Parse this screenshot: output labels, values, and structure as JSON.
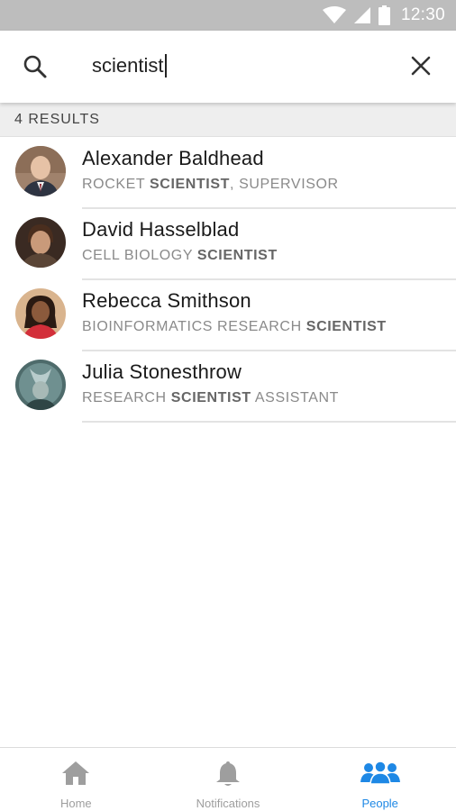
{
  "status_bar": {
    "time": "12:30"
  },
  "search": {
    "query": "scientist"
  },
  "results_header": {
    "count_label": "4 RESULTS"
  },
  "results": [
    {
      "name": "Alexander Baldhead",
      "title_parts": [
        {
          "text": "ROCKET ",
          "bold": false
        },
        {
          "text": "SCIENTIST",
          "bold": true
        },
        {
          "text": ", SUPERVISOR",
          "bold": false
        }
      ]
    },
    {
      "name": "David Hasselblad",
      "title_parts": [
        {
          "text": "CELL BIOLOGY ",
          "bold": false
        },
        {
          "text": "SCIENTIST",
          "bold": true
        }
      ]
    },
    {
      "name": "Rebecca Smithson",
      "title_parts": [
        {
          "text": "BIOINFORMATICS RESEARCH ",
          "bold": false
        },
        {
          "text": "SCIENTIST",
          "bold": true
        }
      ]
    },
    {
      "name": "Julia Stonesthrow",
      "title_parts": [
        {
          "text": "RESEARCH ",
          "bold": false
        },
        {
          "text": "SCIENTIST",
          "bold": true
        },
        {
          "text": " ASSISTANT",
          "bold": false
        }
      ]
    }
  ],
  "bottom_nav": {
    "items": [
      {
        "label": "Home",
        "icon": "home-icon",
        "active": false
      },
      {
        "label": "Notifications",
        "icon": "bell-icon",
        "active": false
      },
      {
        "label": "People",
        "icon": "people-icon",
        "active": true
      }
    ]
  },
  "colors": {
    "status_bar_bg": "#bdbdbd",
    "accent": "#1e88e5",
    "inactive_nav": "#9e9e9e",
    "results_header_bg": "#eeeeee"
  }
}
